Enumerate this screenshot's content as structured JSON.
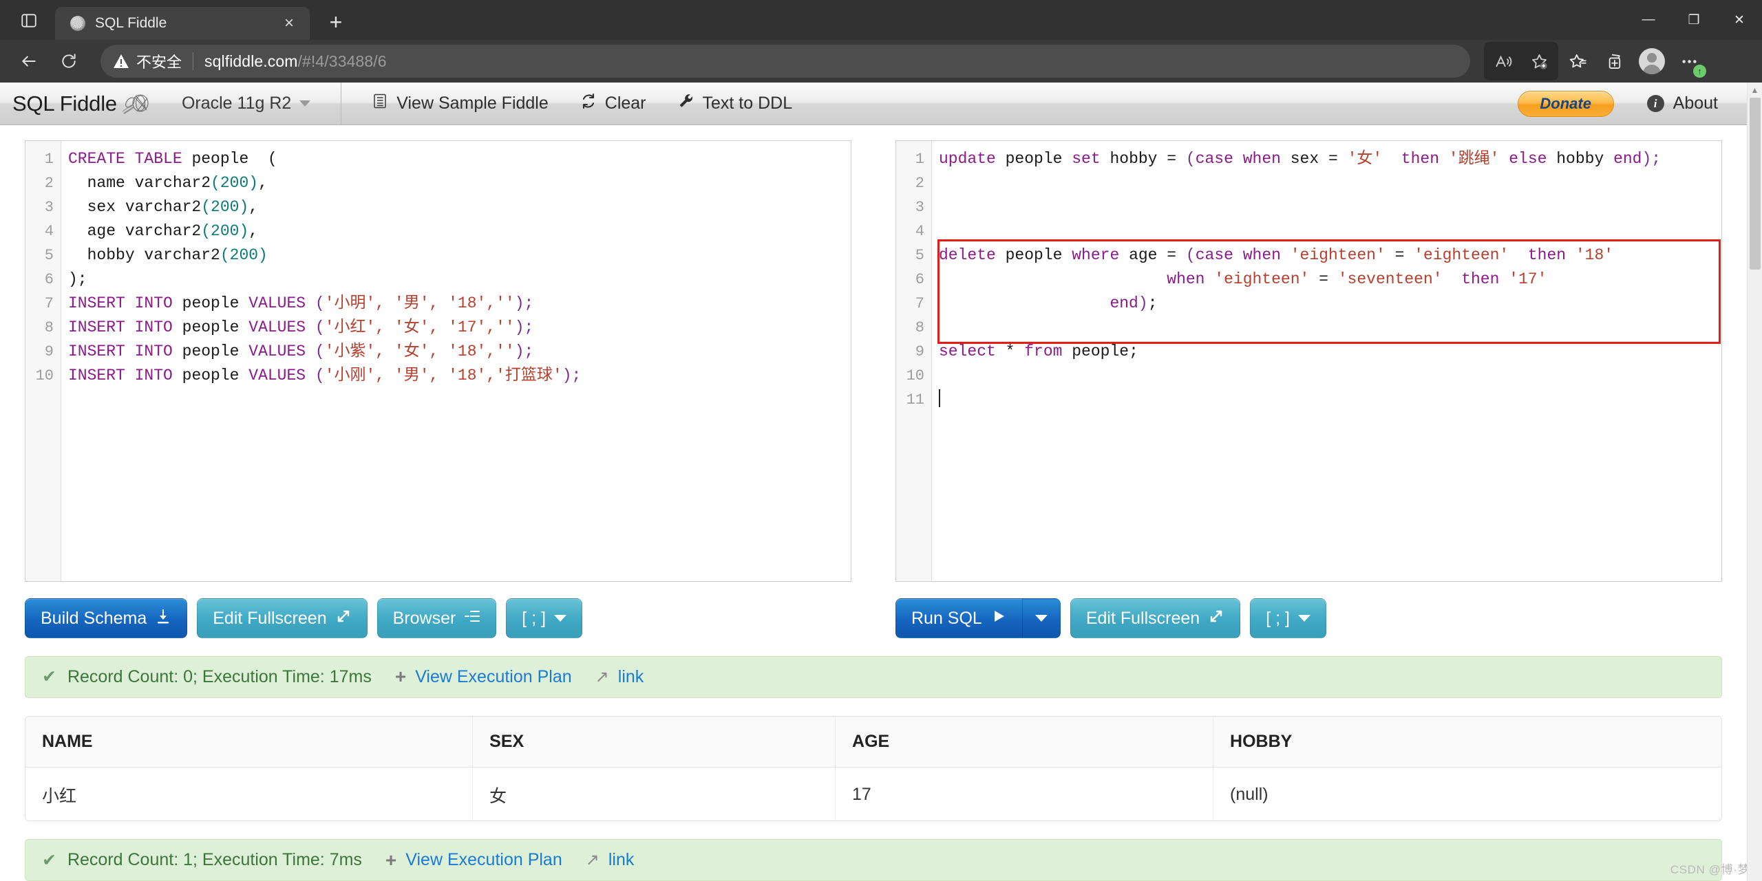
{
  "browser": {
    "tab": {
      "title": "SQL Fiddle",
      "favicon": "fiddle-favicon",
      "close": "×"
    },
    "newtab_label": "+",
    "window_controls": {
      "minimize": "—",
      "maximize": "❐",
      "close": "✕"
    },
    "nav": {
      "back": "back-arrow",
      "reload": "reload-arrow"
    },
    "address": {
      "security_label": "不安全",
      "url_domain": "sqlfiddle.com",
      "url_path": "/#!4/33488/6",
      "full_url": "sqlfiddle.com/#!4/33488/6"
    },
    "toolbar_icons": [
      "read-aloud-icon",
      "add-favorite-icon",
      "favorites-icon",
      "collections-icon",
      "profile-avatar",
      "settings-more-icon"
    ]
  },
  "app": {
    "brand": "SQL Fiddle",
    "database": "Oracle 11g R2",
    "actions": [
      {
        "label": "View Sample Fiddle",
        "icon": "list-document-icon"
      },
      {
        "label": "Clear",
        "icon": "refresh-icon"
      },
      {
        "label": "Text to DDL",
        "icon": "wrench-icon"
      }
    ],
    "donate": "Donate",
    "about": "About"
  },
  "schema_editor": {
    "lines": [
      {
        "n": "1",
        "tokens": [
          {
            "t": "CREATE TABLE ",
            "c": "k"
          },
          {
            "t": "people  (",
            "c": "t"
          }
        ]
      },
      {
        "n": "2",
        "tokens": [
          {
            "t": "  name varchar2",
            "c": "t"
          },
          {
            "t": "(200)",
            "c": "n"
          },
          {
            "t": ",",
            "c": "t"
          }
        ]
      },
      {
        "n": "3",
        "tokens": [
          {
            "t": "  sex varchar2",
            "c": "t"
          },
          {
            "t": "(200)",
            "c": "n"
          },
          {
            "t": ",",
            "c": "t"
          }
        ]
      },
      {
        "n": "4",
        "tokens": [
          {
            "t": "  age varchar2",
            "c": "t"
          },
          {
            "t": "(200)",
            "c": "n"
          },
          {
            "t": ",",
            "c": "t"
          }
        ]
      },
      {
        "n": "5",
        "tokens": [
          {
            "t": "  hobby varchar2",
            "c": "t"
          },
          {
            "t": "(200)",
            "c": "n"
          }
        ]
      },
      {
        "n": "6",
        "tokens": [
          {
            "t": ");",
            "c": "t"
          }
        ]
      },
      {
        "n": "7",
        "tokens": [
          {
            "t": "INSERT INTO ",
            "c": "k"
          },
          {
            "t": "people ",
            "c": "t"
          },
          {
            "t": "VALUES ",
            "c": "k"
          },
          {
            "t": "(",
            "c": "p"
          },
          {
            "t": "'小明', '男', '18',''",
            "c": "s"
          },
          {
            "t": ");",
            "c": "p"
          }
        ]
      },
      {
        "n": "8",
        "tokens": [
          {
            "t": "INSERT INTO ",
            "c": "k"
          },
          {
            "t": "people ",
            "c": "t"
          },
          {
            "t": "VALUES ",
            "c": "k"
          },
          {
            "t": "(",
            "c": "p"
          },
          {
            "t": "'小红', '女', '17',''",
            "c": "s"
          },
          {
            "t": ");",
            "c": "p"
          }
        ]
      },
      {
        "n": "9",
        "tokens": [
          {
            "t": "INSERT INTO ",
            "c": "k"
          },
          {
            "t": "people ",
            "c": "t"
          },
          {
            "t": "VALUES ",
            "c": "k"
          },
          {
            "t": "(",
            "c": "p"
          },
          {
            "t": "'小紫', '女', '18',''",
            "c": "s"
          },
          {
            "t": ");",
            "c": "p"
          }
        ]
      },
      {
        "n": "10",
        "tokens": [
          {
            "t": "INSERT INTO ",
            "c": "k"
          },
          {
            "t": "people ",
            "c": "t"
          },
          {
            "t": "VALUES ",
            "c": "k"
          },
          {
            "t": "(",
            "c": "p"
          },
          {
            "t": "'小刚', '男', '18','打篮球'",
            "c": "s"
          },
          {
            "t": ");",
            "c": "p"
          }
        ]
      }
    ],
    "buttons": [
      {
        "label": "Build Schema",
        "icon": "download-icon",
        "style": "primary"
      },
      {
        "label": "Edit Fullscreen",
        "icon": "expand-icon",
        "style": "teal"
      },
      {
        "label": "Browser",
        "icon": "indent-list-icon",
        "style": "teal"
      },
      {
        "label": "[ ; ]",
        "icon": "chevron-down-icon",
        "style": "teal"
      }
    ]
  },
  "query_editor": {
    "lines": [
      {
        "n": "1",
        "tokens": [
          {
            "t": "update ",
            "c": "k"
          },
          {
            "t": "people ",
            "c": "t"
          },
          {
            "t": "set ",
            "c": "k"
          },
          {
            "t": "hobby = ",
            "c": "t"
          },
          {
            "t": "(",
            "c": "p"
          },
          {
            "t": "case when ",
            "c": "k"
          },
          {
            "t": "sex = ",
            "c": "t"
          },
          {
            "t": "'女'",
            "c": "s"
          },
          {
            "t": "  ",
            "c": "t"
          },
          {
            "t": "then ",
            "c": "k"
          },
          {
            "t": "'跳绳'",
            "c": "s"
          },
          {
            "t": " ",
            "c": "t"
          },
          {
            "t": "else ",
            "c": "k"
          },
          {
            "t": "hobby ",
            "c": "t"
          },
          {
            "t": "end",
            "c": "k"
          },
          {
            "t": ");",
            "c": "p"
          }
        ]
      },
      {
        "n": "2",
        "tokens": []
      },
      {
        "n": "3",
        "tokens": []
      },
      {
        "n": "4",
        "tokens": []
      },
      {
        "n": "5",
        "tokens": [
          {
            "t": "delete ",
            "c": "k"
          },
          {
            "t": "people ",
            "c": "t"
          },
          {
            "t": "where ",
            "c": "k"
          },
          {
            "t": "age = ",
            "c": "t"
          },
          {
            "t": "(",
            "c": "p"
          },
          {
            "t": "case when ",
            "c": "k"
          },
          {
            "t": "'eighteen'",
            "c": "s"
          },
          {
            "t": " = ",
            "c": "t"
          },
          {
            "t": "'eighteen'",
            "c": "s"
          },
          {
            "t": "  ",
            "c": "t"
          },
          {
            "t": "then ",
            "c": "k"
          },
          {
            "t": "'18'",
            "c": "s"
          }
        ]
      },
      {
        "n": "6",
        "tokens": [
          {
            "t": "                        ",
            "c": "t"
          },
          {
            "t": "when ",
            "c": "k"
          },
          {
            "t": "'eighteen'",
            "c": "s"
          },
          {
            "t": " = ",
            "c": "t"
          },
          {
            "t": "'seventeen'",
            "c": "s"
          },
          {
            "t": "  ",
            "c": "t"
          },
          {
            "t": "then ",
            "c": "k"
          },
          {
            "t": "'17'",
            "c": "s"
          }
        ]
      },
      {
        "n": "7",
        "tokens": [
          {
            "t": "                  ",
            "c": "t"
          },
          {
            "t": "end",
            "c": "k"
          },
          {
            "t": ")",
            "c": "p"
          },
          {
            "t": ";",
            "c": "t"
          }
        ]
      },
      {
        "n": "8",
        "tokens": []
      },
      {
        "n": "9",
        "tokens": [
          {
            "t": "select ",
            "c": "k"
          },
          {
            "t": "* ",
            "c": "t"
          },
          {
            "t": "from ",
            "c": "k"
          },
          {
            "t": "people;",
            "c": "t"
          }
        ]
      },
      {
        "n": "10",
        "tokens": []
      },
      {
        "n": "11",
        "tokens": []
      }
    ],
    "highlight_box_color": "#e81b1b",
    "buttons": [
      {
        "label": "Run SQL",
        "icon": "play-icon",
        "style": "primary-split"
      },
      {
        "label": "Edit Fullscreen",
        "icon": "expand-icon",
        "style": "teal"
      },
      {
        "label": "[ ; ]",
        "icon": "chevron-down-icon",
        "style": "teal"
      }
    ]
  },
  "status_top": {
    "check": "✔",
    "text": "Record Count: 0; Execution Time: 17ms",
    "plan_link": "View Execution Plan",
    "link": "link",
    "plus": "+",
    "arrow": "↗"
  },
  "status_bottom": {
    "check": "✔",
    "text": "Record Count: 1; Execution Time: 7ms",
    "plan_link": "View Execution Plan",
    "link": "link",
    "plus": "+",
    "arrow": "↗"
  },
  "results": {
    "columns": [
      "NAME",
      "SEX",
      "AGE",
      "HOBBY"
    ],
    "rows": [
      [
        "小红",
        "女",
        "17",
        "(null)"
      ]
    ]
  },
  "watermark": "CSDN @博·梦",
  "colors": {
    "accent_blue": "#1565c0",
    "teal": "#3fa8c4",
    "status_green_bg": "#dff0d8",
    "status_green_text": "#3c763d",
    "highlight_red": "#e81b1b",
    "donate_orange": "#f79f1f"
  }
}
